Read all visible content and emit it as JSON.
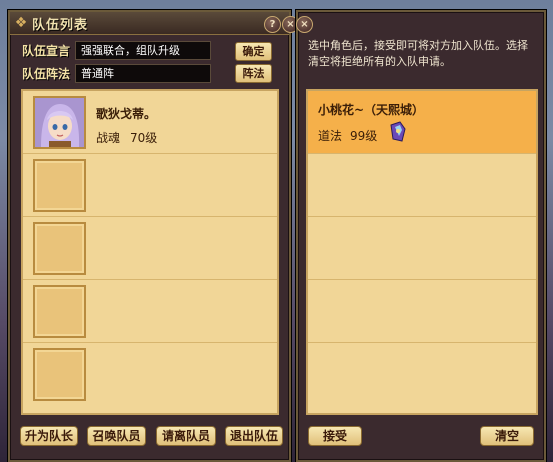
{
  "window": {
    "title": "队伍列表",
    "help_glyph": "?",
    "close_glyph": "×"
  },
  "team": {
    "declaration_label": "队伍宣言",
    "declaration_value": "强强联合，组队升级",
    "confirm_label": "确定",
    "formation_label": "队伍阵法",
    "formation_value": "普通阵",
    "formation_button": "阵法"
  },
  "members": [
    {
      "name": "歌狄戈蒂。",
      "class": "战魂",
      "level": "70级",
      "has_portrait": true
    },
    {
      "name": "",
      "class": "",
      "level": "",
      "has_portrait": false
    },
    {
      "name": "",
      "class": "",
      "level": "",
      "has_portrait": false
    },
    {
      "name": "",
      "class": "",
      "level": "",
      "has_portrait": false
    },
    {
      "name": "",
      "class": "",
      "level": "",
      "has_portrait": false
    }
  ],
  "actions": {
    "promote_leader": "升为队长",
    "summon_member": "召唤队员",
    "kick_member": "请离队员",
    "leave_team": "退出队伍"
  },
  "requests": {
    "hint": "选中角色后，接受即可将对方加入队伍。选择清空将拒绝所有的入队申请。",
    "items": [
      {
        "name": "小桃花~（天熙城）",
        "class": "道法",
        "level": "99级",
        "icon": "taoist-class-icon",
        "selected": true
      },
      {
        "name": "",
        "class": "",
        "level": "",
        "selected": false
      },
      {
        "name": "",
        "class": "",
        "level": "",
        "selected": false
      },
      {
        "name": "",
        "class": "",
        "level": "",
        "selected": false
      },
      {
        "name": "",
        "class": "",
        "level": "",
        "selected": false
      }
    ],
    "accept_label": "接受",
    "clear_label": "清空"
  },
  "colors": {
    "accent_gold": "#f1d697",
    "selected_row": "#f5b04a",
    "panel_frame": "#3b2a2e"
  }
}
